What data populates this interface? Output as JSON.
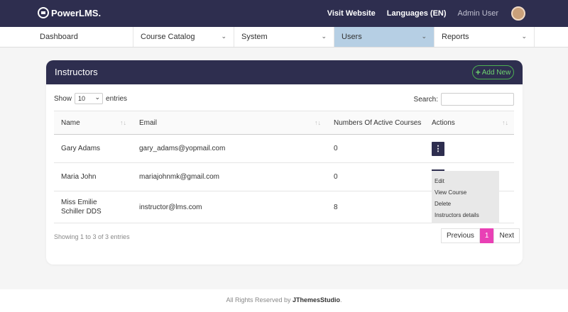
{
  "brand": {
    "logo_text": "PowerLMS."
  },
  "topbar": {
    "visit_website": "Visit Website",
    "languages": "Languages (EN)",
    "user": "Admin User"
  },
  "nav": [
    {
      "label": "Dashboard",
      "has_dropdown": false
    },
    {
      "label": "Course Catalog",
      "has_dropdown": true
    },
    {
      "label": "System",
      "has_dropdown": true
    },
    {
      "label": "Users",
      "has_dropdown": true,
      "active": true
    },
    {
      "label": "Reports",
      "has_dropdown": true
    }
  ],
  "card": {
    "title": "Instructors",
    "add_button": "Add New",
    "show_label": "Show",
    "page_size": "10",
    "entries_label": "entries",
    "search_label": "Search:",
    "search_value": ""
  },
  "table": {
    "headers": [
      "Name",
      "Email",
      "Numbers Of Active Courses",
      "Actions"
    ],
    "rows": [
      {
        "name": "Gary Adams",
        "email": "gary_adams@yopmail.com",
        "courses": "0"
      },
      {
        "name": "Maria John",
        "email": "mariajohnmk@gmail.com",
        "courses": "0"
      },
      {
        "name": "Miss Emilie Schiller DDS",
        "email": "instructor@lms.com",
        "courses": "8"
      }
    ]
  },
  "action_menu": [
    "Edit",
    "View Course",
    "Delete",
    "Instructors details"
  ],
  "table_info": "Showing 1 to 3 of 3 entries",
  "pagination": {
    "previous": "Previous",
    "current": "1",
    "next": "Next"
  },
  "footer": {
    "prefix": "All Rights Reserved by ",
    "brand": "JThemesStudio",
    "suffix": "."
  },
  "colors": {
    "primary": "#2e2e4f",
    "active_nav": "#b6cfe4",
    "accent_green": "#4caf50",
    "page_current": "#e940b5"
  }
}
